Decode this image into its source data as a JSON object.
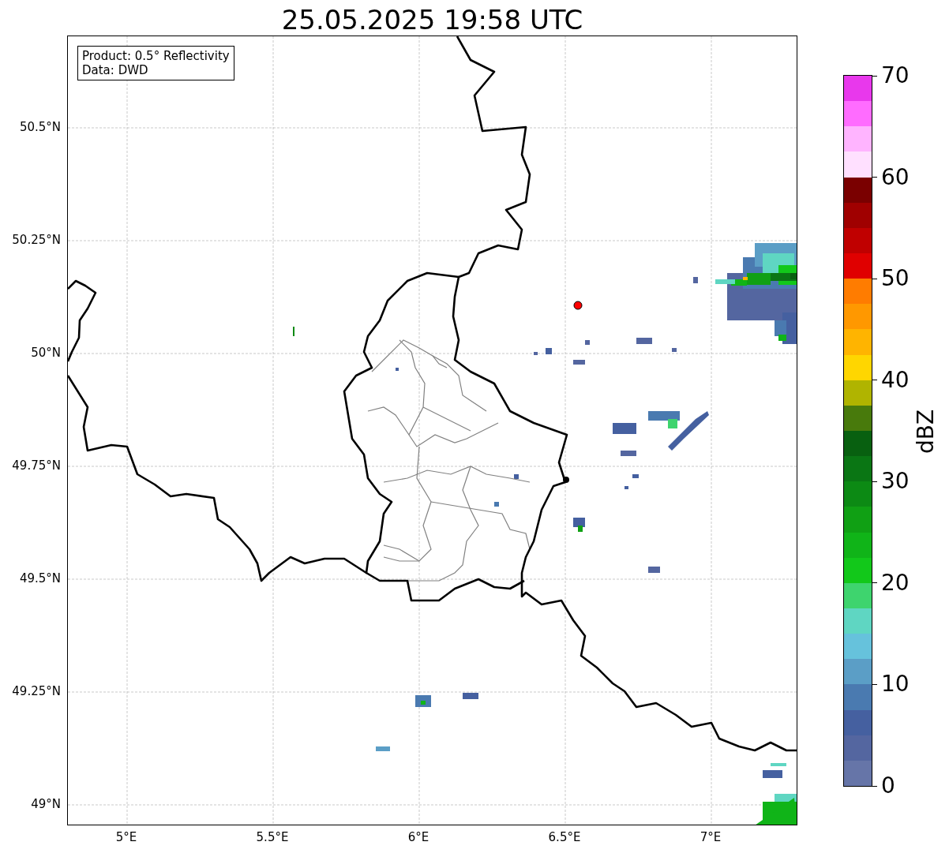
{
  "title": "25.05.2025 19:58 UTC",
  "legend": [
    "Product: 0.5° Reflectivity",
    "Data: DWD"
  ],
  "lat_ticks": [
    "50.5°N",
    "50.25°N",
    "50°N",
    "49.75°N",
    "49.5°N",
    "49.25°N",
    "49°N"
  ],
  "lon_ticks": [
    "5°E",
    "5.5°E",
    "6°E",
    "6.5°E",
    "7°E"
  ],
  "colorbar": {
    "label": "dBZ",
    "ticks": [
      "70",
      "60",
      "50",
      "40",
      "30",
      "20",
      "10",
      "0"
    ],
    "bands": [
      {
        "color": "#e838ec"
      },
      {
        "color": "#ff6cff"
      },
      {
        "color": "#ffb4ff"
      },
      {
        "color": "#ffe0ff"
      },
      {
        "color": "#7a0000"
      },
      {
        "color": "#a00000"
      },
      {
        "color": "#c00000"
      },
      {
        "color": "#e00000"
      },
      {
        "color": "#ff7c00"
      },
      {
        "color": "#ff9800"
      },
      {
        "color": "#ffb400"
      },
      {
        "color": "#ffd600"
      },
      {
        "color": "#b0b400"
      },
      {
        "color": "#487a0c"
      },
      {
        "color": "#086010"
      },
      {
        "color": "#0a7614"
      },
      {
        "color": "#0c8a14"
      },
      {
        "color": "#10a014"
      },
      {
        "color": "#10b418"
      },
      {
        "color": "#12c81a"
      },
      {
        "color": "#3ed46e"
      },
      {
        "color": "#5fd6c2"
      },
      {
        "color": "#66c2dc"
      },
      {
        "color": "#5b9ec6"
      },
      {
        "color": "#4a7ab0"
      },
      {
        "color": "#4560a0"
      },
      {
        "color": "#5466a0"
      },
      {
        "color": "#6675a8"
      }
    ]
  }
}
